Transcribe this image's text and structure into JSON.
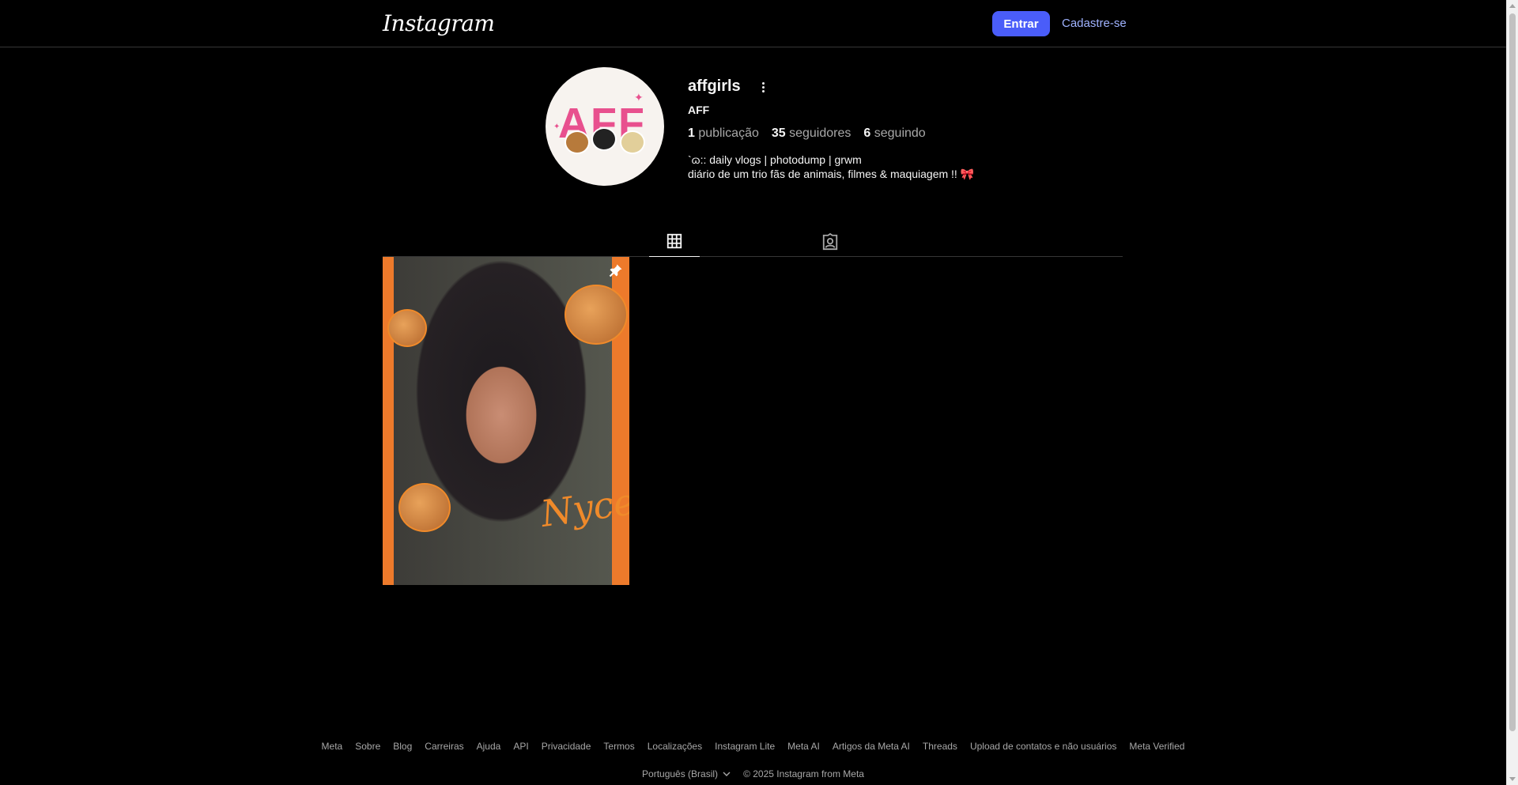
{
  "header": {
    "logo": "Instagram",
    "login_label": "Entrar",
    "signup_label": "Cadastre-se"
  },
  "profile": {
    "username": "affgirls",
    "full_name": "AFF",
    "avatar_text": "AFF",
    "stats": {
      "posts_count": "1",
      "posts_label": "publicação",
      "followers_count": "35",
      "followers_label": "seguidores",
      "following_count": "6",
      "following_label": "seguindo"
    },
    "bio": [
      "`ɷ:: daily vlogs | photodump | grwm",
      "diário de um trio fãs de animais, filmes & maquiagem !! 🎀"
    ]
  },
  "tabs": [
    {
      "icon": "grid-icon",
      "active": true
    },
    {
      "icon": "tagged-icon",
      "active": false
    }
  ],
  "posts": [
    {
      "pinned": true,
      "overlay_text": "Nyce"
    }
  ],
  "footer": {
    "links": [
      "Meta",
      "Sobre",
      "Blog",
      "Carreiras",
      "Ajuda",
      "API",
      "Privacidade",
      "Termos",
      "Localizações",
      "Instagram Lite",
      "Meta AI",
      "Artigos da Meta AI",
      "Threads",
      "Upload de contatos e não usuários",
      "Meta Verified"
    ],
    "language": "Português (Brasil)",
    "copyright": "© 2025 Instagram from Meta"
  },
  "colors": {
    "background": "#000000",
    "primary_button": "#4a5df9",
    "link": "#a0b3ff",
    "muted_text": "#a8a8a8"
  }
}
